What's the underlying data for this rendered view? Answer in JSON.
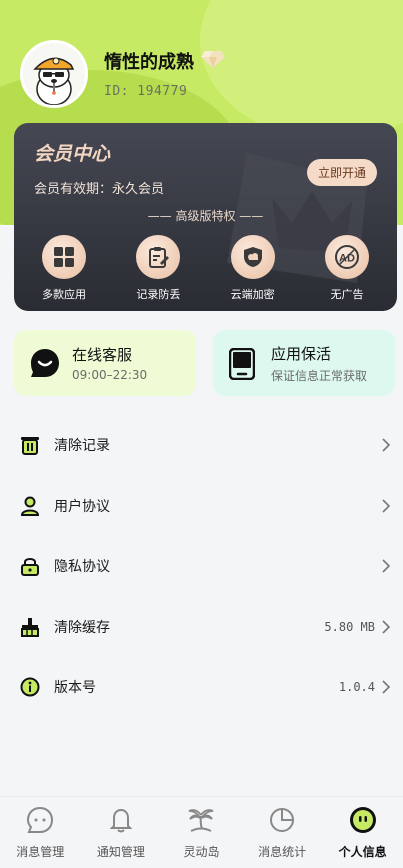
{
  "profile": {
    "username": "惰性的成熟",
    "id": "ID: 194779",
    "avatar_icon": "cartoon-dog-avatar",
    "badge_icon": "diamond-icon"
  },
  "vip": {
    "title": "会员中心",
    "expiry": "会员有效期：永久会员",
    "open_label": "立即开通",
    "privileges_label": "—— 高级版特权 ——",
    "features": [
      {
        "label": "多款应用",
        "icon": "grid-icon"
      },
      {
        "label": "记录防丢",
        "icon": "clipboard-edit-icon"
      },
      {
        "label": "云端加密",
        "icon": "shield-cloud-icon"
      },
      {
        "label": "无广告",
        "icon": "ad-block-icon"
      }
    ]
  },
  "services": {
    "online": {
      "title": "在线客服",
      "subtitle": "09:00–22:30",
      "icon": "chat-bubble-icon"
    },
    "keepalive": {
      "title": "应用保活",
      "subtitle": "保证信息正常获取",
      "icon": "tablet-icon"
    }
  },
  "menu": {
    "items": [
      {
        "label": "清除记录",
        "icon": "trash-icon",
        "value": ""
      },
      {
        "label": "用户协议",
        "icon": "user-icon",
        "value": ""
      },
      {
        "label": "隐私协议",
        "icon": "lock-icon",
        "value": ""
      },
      {
        "label": "清除缓存",
        "icon": "broom-icon",
        "value": "5.80 MB"
      },
      {
        "label": "版本号",
        "icon": "info-icon",
        "value": "1.0.4"
      }
    ]
  },
  "tabs": [
    {
      "label": "消息管理",
      "icon": "message-icon"
    },
    {
      "label": "通知管理",
      "icon": "bell-icon"
    },
    {
      "label": "灵动岛",
      "icon": "island-palm-icon"
    },
    {
      "label": "消息统计",
      "icon": "pie-chart-icon"
    },
    {
      "label": "个人信息",
      "icon": "face-icon",
      "active": true
    }
  ],
  "colors": {
    "accent": "#c6ea63",
    "vip_dark": "#2a2c33",
    "vip_gold": "#f3d6c2"
  }
}
